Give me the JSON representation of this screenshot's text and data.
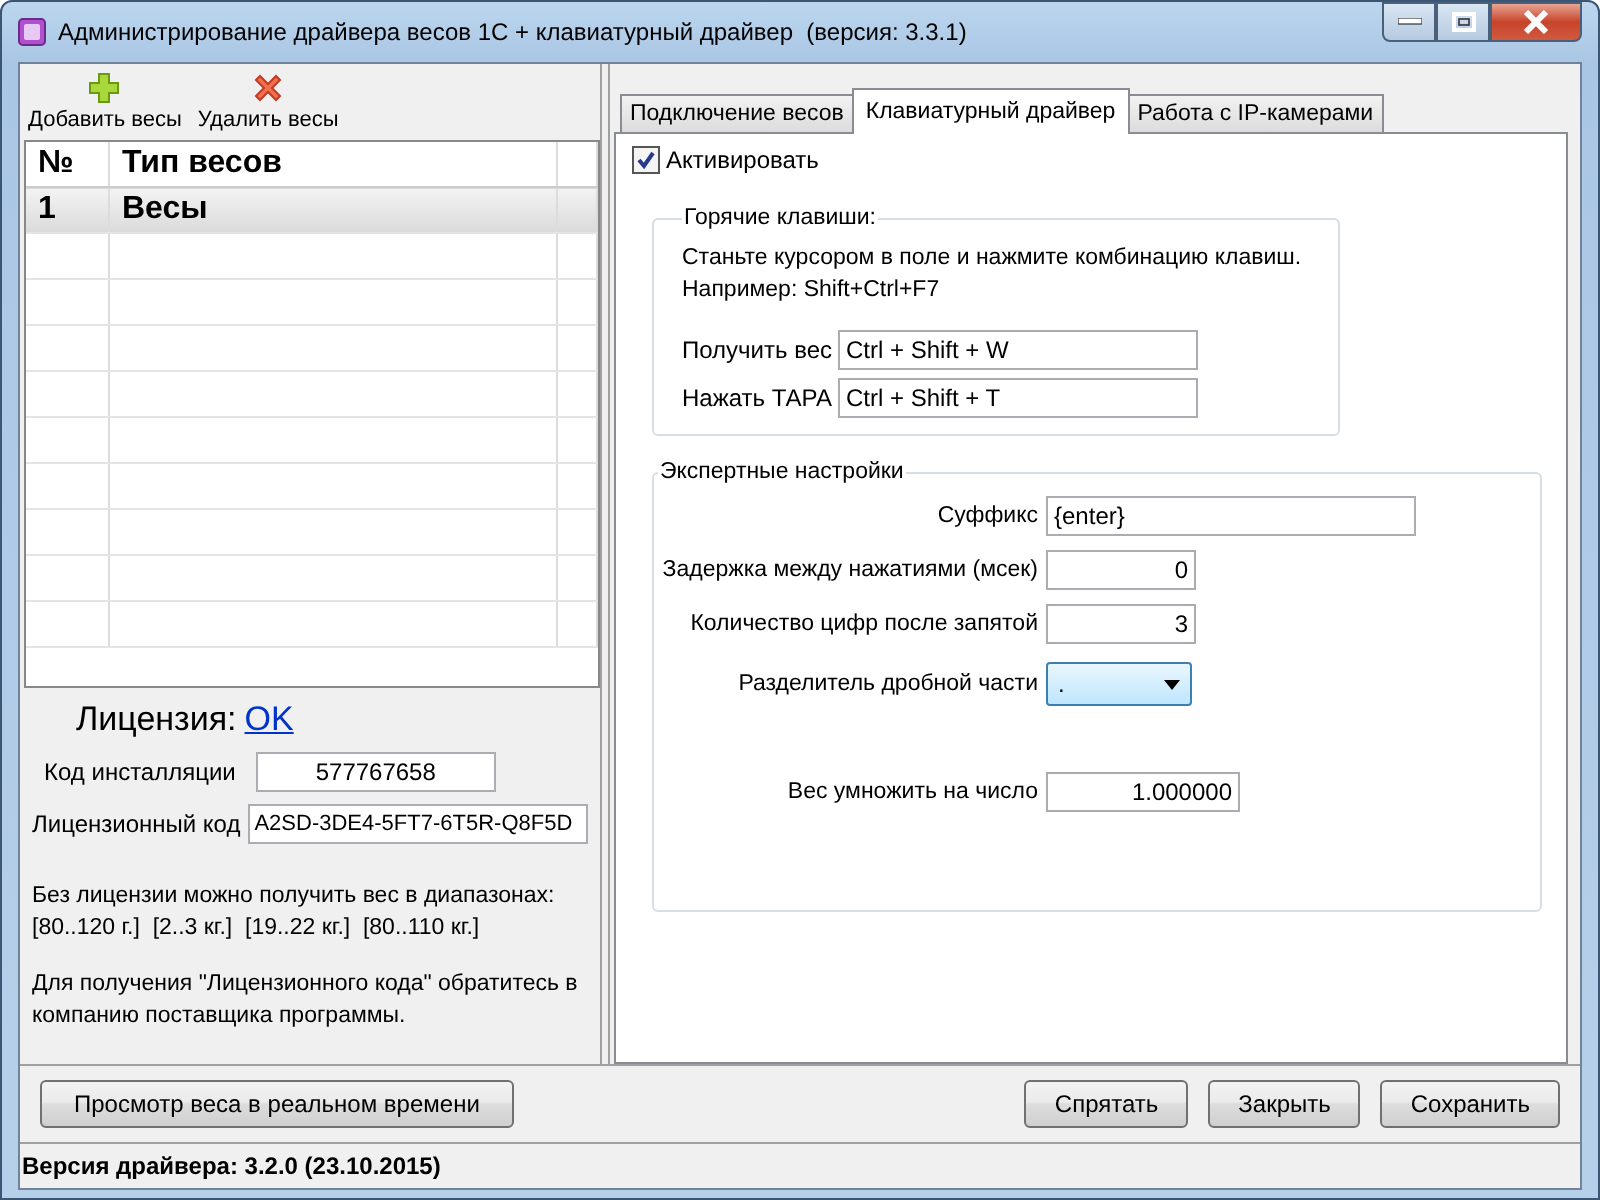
{
  "window": {
    "title": "Администрирование драйвера весов 1С + клавиатурный драйвер  (версия: 3.3.1)"
  },
  "toolbar": [
    {
      "kind": "add",
      "label": "Добавить весы"
    },
    {
      "kind": "remove",
      "label": "Удалить весы"
    }
  ],
  "table": {
    "columns": [
      "№",
      "Тип весов"
    ],
    "rows": [
      {
        "cells": [
          "1",
          "Весы"
        ],
        "selected": true
      }
    ]
  },
  "license": {
    "label": "Лицензия:",
    "status": "OK",
    "install_code_label": "Код инсталляции",
    "install_code": "577767658",
    "license_code_label": "Лицензионный код",
    "license_code": "A2SD-3DE4-5FT7-6T5R-Q8F5D",
    "note": "Без лицензии можно получить вес в диапазонах:",
    "ranges": "[80..120 г.]  [2..3 кг.]  [19..22 кг.]  [80..110 кг.]",
    "contact": "Для получения \"Лицензионного кода\" обратитесь в компанию поставщика программы."
  },
  "tabs": [
    {
      "label": "Подключение весов",
      "selected": false
    },
    {
      "label": "Клавиатурный драйвер",
      "selected": true
    },
    {
      "label": "Работа с IP-камерами",
      "selected": false
    }
  ],
  "activate": {
    "label": "Активировать",
    "checked": true
  },
  "hotkeys": {
    "title": "Горячие клавиши:",
    "hint": "Станьте курсором в поле и нажмите комбинацию клавиш.",
    "example": "Например: Shift+Ctrl+F7",
    "fields": [
      {
        "label": "Получить вес",
        "value": "Ctrl + Shift + W"
      },
      {
        "label": "Нажать ТАРА",
        "value": "Ctrl + Shift + T"
      }
    ]
  },
  "expert": {
    "title": "Экспертные настройки",
    "fields": [
      {
        "kind": "text",
        "label": "Суффикс",
        "value": "{enter}"
      },
      {
        "kind": "number",
        "label": "Задержка между нажатиями (мсек)",
        "value": "0"
      },
      {
        "kind": "number",
        "label": "Количество цифр после запятой",
        "value": "3"
      },
      {
        "kind": "select",
        "label": "Разделитель дробной части",
        "value": "."
      },
      {
        "kind": "number",
        "label": "Вес умножить на число",
        "value": "1.000000"
      }
    ]
  },
  "buttons": {
    "left": [
      "Просмотр веса в реальном времени"
    ],
    "right": [
      "Спрятать",
      "Закрыть",
      "Сохранить"
    ]
  },
  "status_bar": "Версия драйвера: 3.2.0 (23.10.2015)"
}
